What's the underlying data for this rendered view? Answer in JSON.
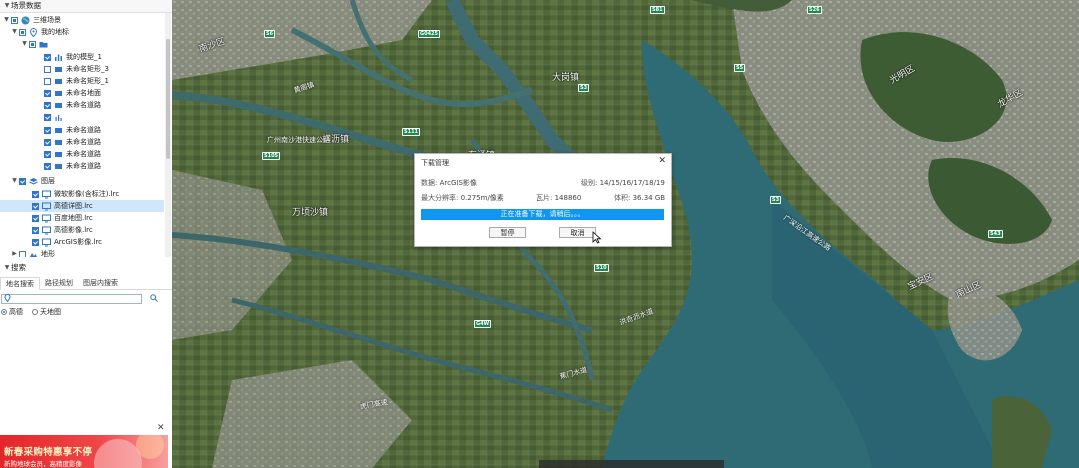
{
  "scene_panel": {
    "header": "场景数据",
    "items": [
      {
        "label": "三维场景"
      },
      {
        "label": "我的地标"
      },
      {
        "label": ""
      },
      {
        "label": "我的模型_1"
      },
      {
        "label": "未命名矩形_3"
      },
      {
        "label": "未命名矩形_1"
      },
      {
        "label": "未命名地面"
      },
      {
        "label": "未命名道路"
      },
      {
        "label": ""
      },
      {
        "label": "未命名道路"
      },
      {
        "label": "未命名道路"
      },
      {
        "label": "未命名道路"
      },
      {
        "label": "未命名道路"
      },
      {
        "label": "图层"
      },
      {
        "label": "微软影像(含标注).lrc"
      },
      {
        "label": "高德详图.lrc"
      },
      {
        "label": "百度地图.lrc"
      },
      {
        "label": "高德影像.lrc"
      },
      {
        "label": "ArcGIS影像.lrc"
      },
      {
        "label": "地形"
      }
    ]
  },
  "search_panel": {
    "header": "搜索",
    "tabs": [
      "地名搜索",
      "路径规划",
      "图层内搜索"
    ],
    "input_value": "",
    "radios": [
      {
        "label": "高德",
        "checked": true
      },
      {
        "label": "天地图",
        "checked": false
      }
    ]
  },
  "ad": {
    "headline": "新春采购特惠享不停",
    "subline": "新购地球会员，高精度影像"
  },
  "map": {
    "places": [
      "南沙区",
      "大岗镇",
      "横沥镇",
      "万顷沙镇",
      "光明区",
      "龙华区",
      "宝安区",
      "南山区",
      "洪奇沥水道",
      "蕉门水道",
      "东涌镇",
      "黄阁镇",
      "中山区",
      "石岐",
      "民众街道",
      "沙溪",
      "坦洲",
      "龙穴岛"
    ],
    "roads": [
      "广州南沙港快速公路",
      "广深沿江高速公路",
      "虎门高速",
      "南沙大桥",
      "深中通道"
    ],
    "shields": [
      "S6",
      "S81",
      "S26",
      "G0425",
      "S105",
      "S111",
      "S3",
      "S5",
      "S3",
      "G4W",
      "S43",
      "S10"
    ]
  },
  "dialog": {
    "title": "下载管理",
    "source_label": "数据:",
    "source_value": "ArcGIS影像",
    "level_label": "级别:",
    "level_value": "14/15/16/17/18/19",
    "resolution_label": "最大分辨率:",
    "resolution_value": "0.275m/像素",
    "tiles_label": "瓦片:",
    "tiles_value": "148860",
    "size_label": "体积:",
    "size_value": "36.34 GB",
    "progress_text": "正在准备下载，请稍后。。。",
    "progress": 1.0,
    "pause_button": "暂停",
    "cancel_button": "取消"
  }
}
